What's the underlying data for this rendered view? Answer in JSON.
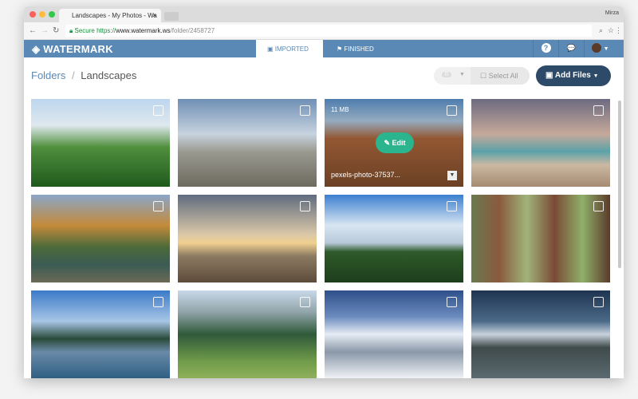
{
  "browser": {
    "tab_title": "Landscapes - My Photos - Wa",
    "tab_close": "×",
    "user": "Mirza",
    "secure": "Secure",
    "url_scheme": "https://",
    "url_host": "www.watermark.ws",
    "url_path": "/folder/2458727"
  },
  "app": {
    "logo": "WATERMARK",
    "tabs": [
      {
        "label": "IMPORTED",
        "icon": "image-icon"
      },
      {
        "label": "FINISHED",
        "icon": "flag-icon"
      }
    ],
    "help_icon": "?",
    "chat_icon": "💬"
  },
  "breadcrumb": {
    "root": "Folders",
    "sep": "/",
    "current": "Landscapes"
  },
  "toolbar": {
    "count": "0",
    "select_all": "Select All",
    "add_files": "Add Files"
  },
  "colors": {
    "brand": "#5b89b5",
    "edit": "#2bb58e",
    "add_button": "#2d4a68"
  },
  "photos": [
    {
      "bg": "linear-gradient(#bcd6ee 0%,#dfe8ee 30%,#4f8f3c 55%,#1f5a1d 100%)"
    },
    {
      "bg": "linear-gradient(#6f8fb5 0%,#c7d3df 40%,#9a9a90 60%,#6d6a5f 100%)"
    },
    {
      "bg": "linear-gradient(#5a8fc6 0%,#a9c3db 25%,#a8643a 45%,#7a4a2a 100%)",
      "size": "11 MB",
      "name": "pexels-photo-37537...",
      "hover": true,
      "edit": "Edit"
    },
    {
      "bg": "linear-gradient(#6d6a80 0%,#c6a99a 40%,#5ba2a9 60%,#cbb8a3 75%,#a68b72 100%)"
    },
    {
      "bg": "linear-gradient(#8aa6c8 0%,#c48a3a 35%,#4b6a3a 60%,#3b5b54 80%,#6c6a55 100%)"
    },
    {
      "bg": "linear-gradient(#5f6b7e 0%,#d9c7a8 45%,#f0d090 55%,#8b7a62 70%,#5d4c3a 100%)"
    },
    {
      "bg": "linear-gradient(#3b7fd0 0%,#d9e6f2 35%,#b7c8d8 55%,#2f5a2a 65%,#1e3d1c 100%)"
    },
    {
      "bg": "linear-gradient(90deg,#6a7a4f 0%,#8a5a3e 20%,#a0b47a 40%,#7a4a36 60%,#8fb06a 80%,#5a3a2a 100%)"
    },
    {
      "bg": "linear-gradient(#3b7ac8 0%,#a8c6e6 35%,#2a4a3a 55%,#6a8aa8 70%,#2f5f83 100%)"
    },
    {
      "bg": "linear-gradient(#c8d8e8 0%,#8fa3a8 25%,#2f5a3a 50%,#6f9a4a 80%,#8fb05a 100%)"
    },
    {
      "bg": "linear-gradient(#2e4f8a 0%,#6c8cbf 30%,#e6ecf4 50%,#8a98a8 70%,#f0f2f6 100%)"
    },
    {
      "bg": "linear-gradient(#1f3450 0%,#4a6a88 35%,#c8d2dc 50%,#3f4a4a 65%,#5a6a70 100%)"
    }
  ]
}
